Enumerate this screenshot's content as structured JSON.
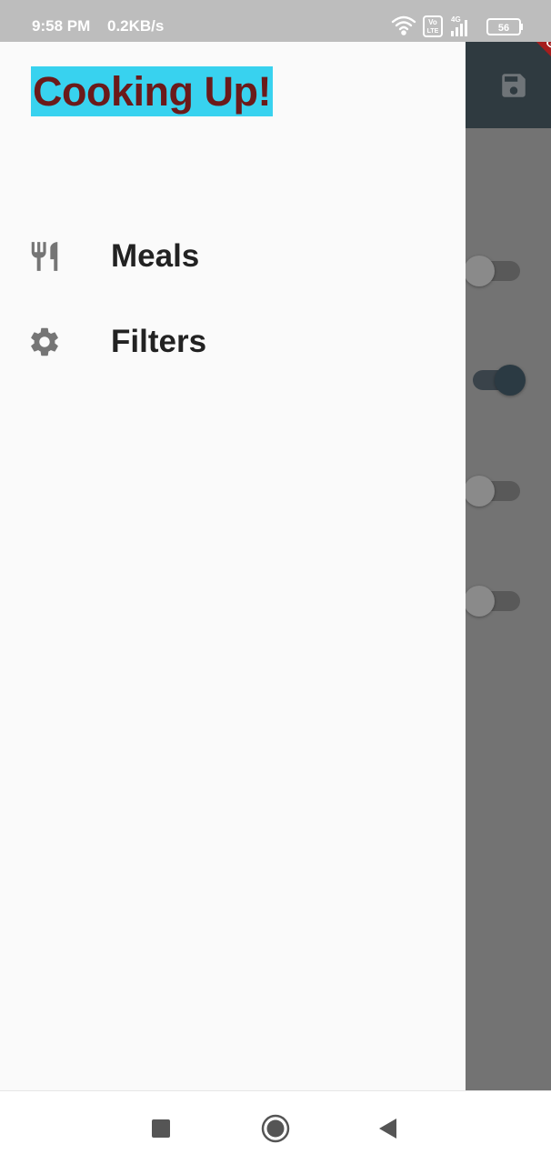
{
  "status_bar": {
    "time": "9:58 PM",
    "speed": "0.2KB/s",
    "icons": [
      "wifi-icon",
      "volte-icon",
      "signal-icon",
      "battery-icon"
    ],
    "volte_label": "Vo LTE",
    "network_label": "4G",
    "battery_level": "56"
  },
  "debug_banner": {
    "label": "DEBUG",
    "color": "#a61d1d"
  },
  "app_bar": {
    "action_icon": "save-icon",
    "color": "#2f3a40"
  },
  "filters": {
    "switches": [
      {
        "on": false
      },
      {
        "on": true
      },
      {
        "on": false
      },
      {
        "on": false
      }
    ]
  },
  "drawer": {
    "title": "Cooking Up!",
    "title_bg": "#38d2ef",
    "title_color": "#6b1a1a",
    "items": [
      {
        "label": "Meals",
        "icon": "restaurant-icon"
      },
      {
        "label": "Filters",
        "icon": "settings-gear-icon"
      }
    ]
  },
  "nav_bar": {
    "buttons": [
      "recents-square-icon",
      "home-circle-icon",
      "back-triangle-icon"
    ]
  }
}
